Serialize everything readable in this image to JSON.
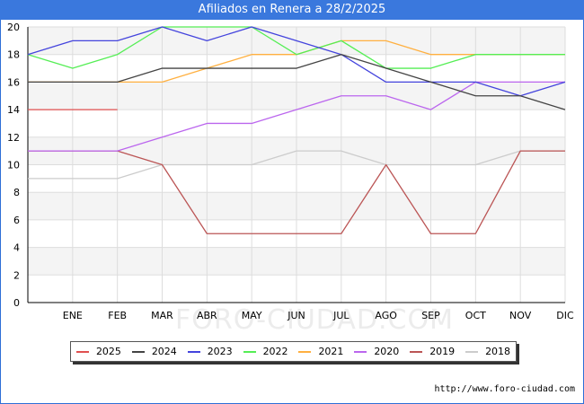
{
  "title": "Afiliados en Renera a 28/2/2025",
  "source": "http://www.foro-ciudad.com",
  "watermark": "FORO-CIUDAD.COM",
  "chart_data": {
    "type": "line",
    "categories": [
      "",
      "ENE",
      "FEB",
      "MAR",
      "ABR",
      "MAY",
      "JUN",
      "JUL",
      "AGO",
      "SEP",
      "OCT",
      "NOV",
      "DIC"
    ],
    "ylim": [
      0,
      20
    ],
    "yticks": [
      "0",
      "2",
      "4",
      "6",
      "8",
      "10",
      "12",
      "14",
      "16",
      "18",
      "20"
    ],
    "grid": true,
    "legend_position": "bottom",
    "series": [
      {
        "name": "2025",
        "color": "#e05050",
        "values": [
          14,
          14,
          14
        ]
      },
      {
        "name": "2024",
        "color": "#444444",
        "values": [
          16,
          16,
          16,
          17,
          17,
          17,
          17,
          18,
          17,
          16,
          15,
          15,
          14
        ]
      },
      {
        "name": "2023",
        "color": "#4444dd",
        "values": [
          18,
          19,
          19,
          20,
          19,
          20,
          19,
          18,
          16,
          16,
          16,
          15,
          16
        ]
      },
      {
        "name": "2022",
        "color": "#55ee55",
        "values": [
          18,
          17,
          18,
          20,
          20,
          20,
          18,
          19,
          17,
          17,
          18,
          18,
          18
        ]
      },
      {
        "name": "2021",
        "color": "#ffb040",
        "values": [
          16,
          16,
          16,
          16,
          17,
          18,
          18,
          19,
          19,
          18,
          18,
          18,
          18
        ]
      },
      {
        "name": "2020",
        "color": "#bb66ee",
        "values": [
          11,
          11,
          11,
          12,
          13,
          13,
          14,
          15,
          15,
          14,
          16,
          16,
          16
        ]
      },
      {
        "name": "2019",
        "color": "#bb5555",
        "values": [
          11,
          11,
          11,
          10,
          5,
          5,
          5,
          5,
          10,
          5,
          5,
          11,
          11
        ]
      },
      {
        "name": "2018",
        "color": "#cccccc",
        "values": [
          9,
          9,
          9,
          10,
          10,
          10,
          11,
          11,
          10,
          10,
          10,
          11,
          11
        ]
      }
    ]
  }
}
